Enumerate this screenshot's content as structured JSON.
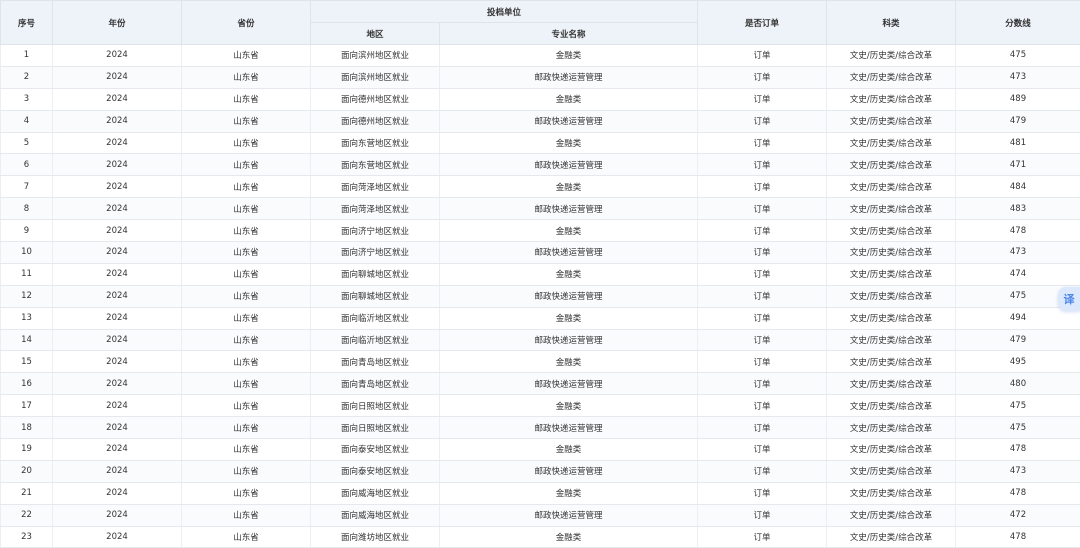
{
  "headers": {
    "seq": "序号",
    "year": "年份",
    "province": "省份",
    "unit_group": "投档单位",
    "region": "地区",
    "major": "专业名称",
    "is_order": "是否订单",
    "subject": "科类",
    "score": "分数线"
  },
  "rows": [
    {
      "seq": "1",
      "year": "2024",
      "province": "山东省",
      "region": "面向滨州地区就业",
      "major": "金融类",
      "is_order": "订单",
      "subject": "文史/历史类/综合改革",
      "score": "475"
    },
    {
      "seq": "2",
      "year": "2024",
      "province": "山东省",
      "region": "面向滨州地区就业",
      "major": "邮政快递运营管理",
      "is_order": "订单",
      "subject": "文史/历史类/综合改革",
      "score": "473"
    },
    {
      "seq": "3",
      "year": "2024",
      "province": "山东省",
      "region": "面向德州地区就业",
      "major": "金融类",
      "is_order": "订单",
      "subject": "文史/历史类/综合改革",
      "score": "489"
    },
    {
      "seq": "4",
      "year": "2024",
      "province": "山东省",
      "region": "面向德州地区就业",
      "major": "邮政快递运营管理",
      "is_order": "订单",
      "subject": "文史/历史类/综合改革",
      "score": "479"
    },
    {
      "seq": "5",
      "year": "2024",
      "province": "山东省",
      "region": "面向东营地区就业",
      "major": "金融类",
      "is_order": "订单",
      "subject": "文史/历史类/综合改革",
      "score": "481"
    },
    {
      "seq": "6",
      "year": "2024",
      "province": "山东省",
      "region": "面向东营地区就业",
      "major": "邮政快递运营管理",
      "is_order": "订单",
      "subject": "文史/历史类/综合改革",
      "score": "471"
    },
    {
      "seq": "7",
      "year": "2024",
      "province": "山东省",
      "region": "面向菏泽地区就业",
      "major": "金融类",
      "is_order": "订单",
      "subject": "文史/历史类/综合改革",
      "score": "484"
    },
    {
      "seq": "8",
      "year": "2024",
      "province": "山东省",
      "region": "面向菏泽地区就业",
      "major": "邮政快递运营管理",
      "is_order": "订单",
      "subject": "文史/历史类/综合改革",
      "score": "483"
    },
    {
      "seq": "9",
      "year": "2024",
      "province": "山东省",
      "region": "面向济宁地区就业",
      "major": "金融类",
      "is_order": "订单",
      "subject": "文史/历史类/综合改革",
      "score": "478"
    },
    {
      "seq": "10",
      "year": "2024",
      "province": "山东省",
      "region": "面向济宁地区就业",
      "major": "邮政快递运营管理",
      "is_order": "订单",
      "subject": "文史/历史类/综合改革",
      "score": "473"
    },
    {
      "seq": "11",
      "year": "2024",
      "province": "山东省",
      "region": "面向聊城地区就业",
      "major": "金融类",
      "is_order": "订单",
      "subject": "文史/历史类/综合改革",
      "score": "474"
    },
    {
      "seq": "12",
      "year": "2024",
      "province": "山东省",
      "region": "面向聊城地区就业",
      "major": "邮政快递运营管理",
      "is_order": "订单",
      "subject": "文史/历史类/综合改革",
      "score": "475"
    },
    {
      "seq": "13",
      "year": "2024",
      "province": "山东省",
      "region": "面向临沂地区就业",
      "major": "金融类",
      "is_order": "订单",
      "subject": "文史/历史类/综合改革",
      "score": "494"
    },
    {
      "seq": "14",
      "year": "2024",
      "province": "山东省",
      "region": "面向临沂地区就业",
      "major": "邮政快递运营管理",
      "is_order": "订单",
      "subject": "文史/历史类/综合改革",
      "score": "479"
    },
    {
      "seq": "15",
      "year": "2024",
      "province": "山东省",
      "region": "面向青岛地区就业",
      "major": "金融类",
      "is_order": "订单",
      "subject": "文史/历史类/综合改革",
      "score": "495"
    },
    {
      "seq": "16",
      "year": "2024",
      "province": "山东省",
      "region": "面向青岛地区就业",
      "major": "邮政快递运营管理",
      "is_order": "订单",
      "subject": "文史/历史类/综合改革",
      "score": "480"
    },
    {
      "seq": "17",
      "year": "2024",
      "province": "山东省",
      "region": "面向日照地区就业",
      "major": "金融类",
      "is_order": "订单",
      "subject": "文史/历史类/综合改革",
      "score": "475"
    },
    {
      "seq": "18",
      "year": "2024",
      "province": "山东省",
      "region": "面向日照地区就业",
      "major": "邮政快递运营管理",
      "is_order": "订单",
      "subject": "文史/历史类/综合改革",
      "score": "475"
    },
    {
      "seq": "19",
      "year": "2024",
      "province": "山东省",
      "region": "面向泰安地区就业",
      "major": "金融类",
      "is_order": "订单",
      "subject": "文史/历史类/综合改革",
      "score": "478"
    },
    {
      "seq": "20",
      "year": "2024",
      "province": "山东省",
      "region": "面向泰安地区就业",
      "major": "邮政快递运营管理",
      "is_order": "订单",
      "subject": "文史/历史类/综合改革",
      "score": "473"
    },
    {
      "seq": "21",
      "year": "2024",
      "province": "山东省",
      "region": "面向威海地区就业",
      "major": "金融类",
      "is_order": "订单",
      "subject": "文史/历史类/综合改革",
      "score": "478"
    },
    {
      "seq": "22",
      "year": "2024",
      "province": "山东省",
      "region": "面向威海地区就业",
      "major": "邮政快递运营管理",
      "is_order": "订单",
      "subject": "文史/历史类/综合改革",
      "score": "472"
    },
    {
      "seq": "23",
      "year": "2024",
      "province": "山东省",
      "region": "面向潍坊地区就业",
      "major": "金融类",
      "is_order": "订单",
      "subject": "文史/历史类/综合改革",
      "score": "478"
    }
  ],
  "translate_button": {
    "label": "译",
    "icon": "translate-icon",
    "color": "#4c86e8"
  }
}
